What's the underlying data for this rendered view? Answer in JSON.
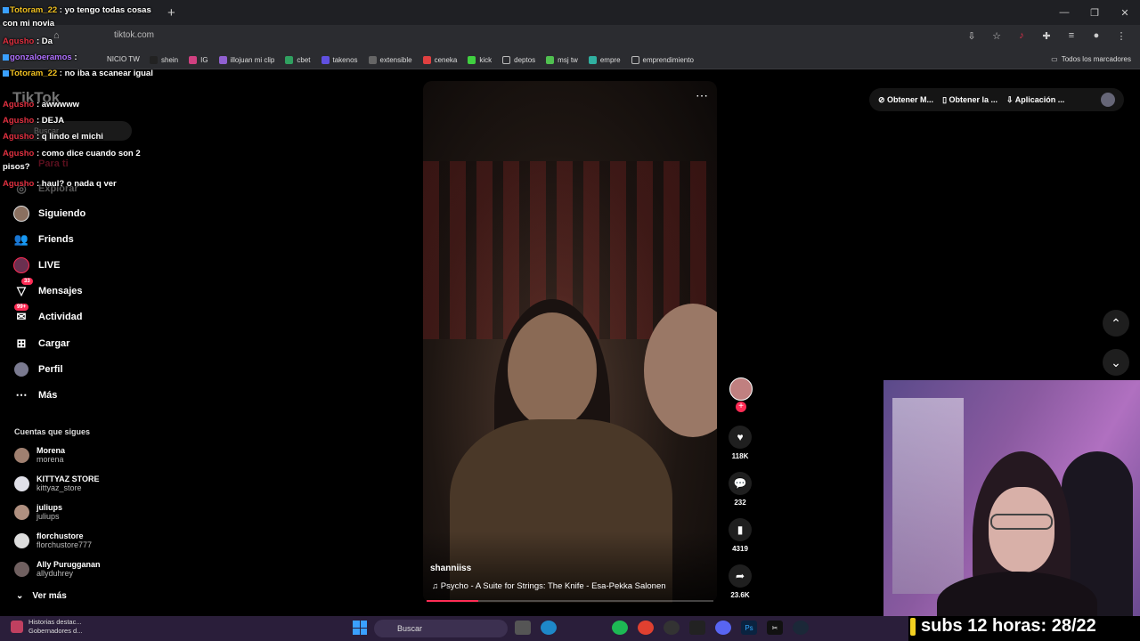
{
  "browser": {
    "url": "tiktok.com",
    "bookmarks": [
      "shein",
      "IG",
      "illojuan mi clip",
      "cbet",
      "takenos",
      "extensible",
      "ceneka",
      "kick",
      "deptos",
      "msj tw",
      "empre",
      "emprendimiento"
    ],
    "all_bookmarks": "Todos los marcadores",
    "bookmark_partial": "NICIO TW"
  },
  "tiktok": {
    "logo": "TikTok",
    "search_placeholder": "Buscar",
    "nav": {
      "para_ti": "Para ti",
      "explorar": "Explorar",
      "siguiendo": "Siguiendo",
      "friends": "Friends",
      "live": "LIVE",
      "mensajes": "Mensajes",
      "mensajes_badge": "33",
      "actividad": "Actividad",
      "actividad_badge": "99+",
      "cargar": "Cargar",
      "perfil": "Perfil",
      "mas": "Más"
    },
    "following_heading": "Cuentas que sigues",
    "following": [
      {
        "name": "Morena",
        "handle": "morena"
      },
      {
        "name": "KITTYAZ STORE",
        "handle": "kittyaz_store"
      },
      {
        "name": "juliups",
        "handle": "juliups"
      },
      {
        "name": "florchustore",
        "handle": "florchustore777"
      },
      {
        "name": "Ally Purugganan",
        "handle": "allyduhrey"
      }
    ],
    "ver_mas": "Ver más",
    "top_buttons": [
      "Obtener M...",
      "Obtener la ...",
      "Aplicación ..."
    ],
    "video": {
      "author": "shanniiss",
      "music": "Psycho - A Suite for Strings: The Knife - Esa-Pekka Salonen",
      "likes": "118K",
      "comments": "232",
      "saves": "4319",
      "shares": "23.6K",
      "progress": 0.18
    }
  },
  "chat": [
    {
      "user": "Totoram_22",
      "text": ": yo tengo todas cosas con mi novia"
    },
    {
      "user": "Agusho",
      "text": ": Da"
    },
    {
      "user": "gonzaloeramos",
      "text": ":"
    },
    {
      "user": "Totoram_22",
      "text": ": no iba a scanear igual"
    },
    {
      "user": "Agusho",
      "text": ": awwwww"
    },
    {
      "user": "Agusho",
      "text": ": DEJA"
    },
    {
      "user": "Agusho",
      "text": ": q lindo el michi"
    },
    {
      "user": "Agusho",
      "text": ": como dice cuando son 2 pisos?"
    },
    {
      "user": "Agusho",
      "text": ": haul? o nada q ver"
    }
  ],
  "stream_overlay": {
    "subs_text": "subs 12 horas: 28/22"
  },
  "taskbar": {
    "news_title": "Historias destac...",
    "news_sub": "Gobernadores d...",
    "search": "Buscar"
  }
}
